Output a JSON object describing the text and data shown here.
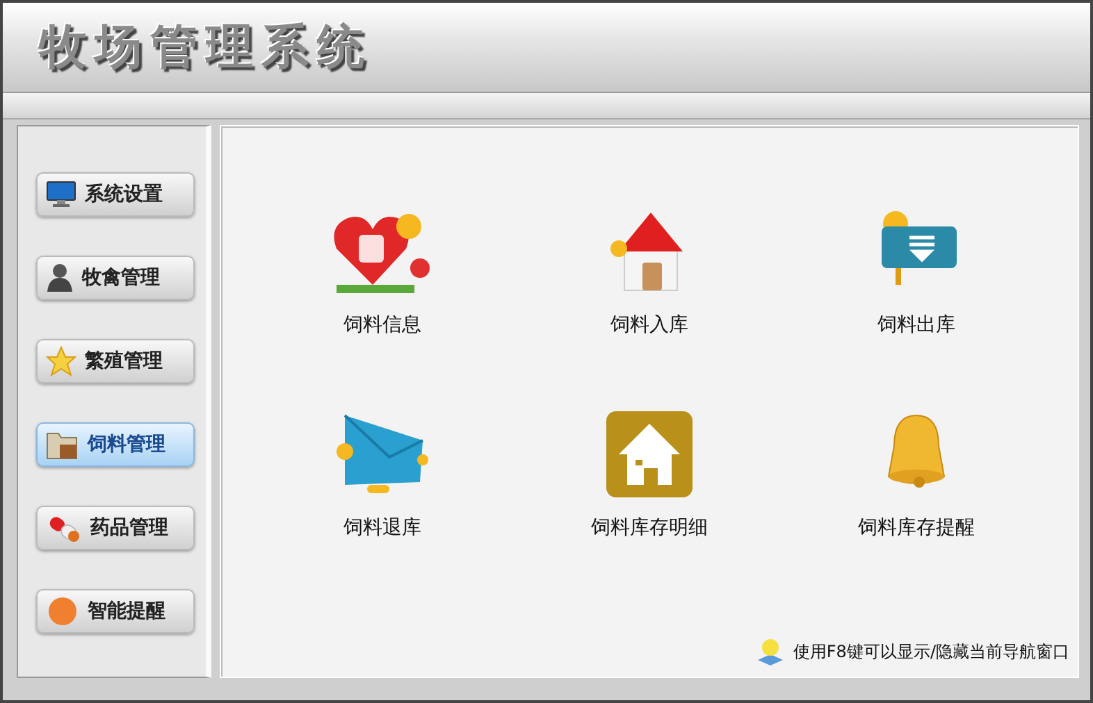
{
  "window": {
    "title": "牧场管理系统"
  },
  "sidebar": {
    "items": [
      {
        "label": "系统设置",
        "kind": "monitor",
        "selected": false
      },
      {
        "label": "牧禽管理",
        "kind": "person",
        "selected": false
      },
      {
        "label": "繁殖管理",
        "kind": "star",
        "selected": false
      },
      {
        "label": "饲料管理",
        "kind": "folder",
        "selected": true
      },
      {
        "label": "药品管理",
        "kind": "pill",
        "selected": false
      },
      {
        "label": "智能提醒",
        "kind": "avatar",
        "selected": false
      }
    ]
  },
  "tiles": [
    {
      "label": "饲料信息",
      "kind": "heart"
    },
    {
      "label": "饲料入库",
      "kind": "house"
    },
    {
      "label": "饲料出库",
      "kind": "card"
    },
    {
      "label": "饲料退库",
      "kind": "envelope"
    },
    {
      "label": "饲料库存明细",
      "kind": "home-square"
    },
    {
      "label": "饲料库存提醒",
      "kind": "bell"
    }
  ],
  "hint": "使用F8键可以显示/隐藏当前导航窗口"
}
